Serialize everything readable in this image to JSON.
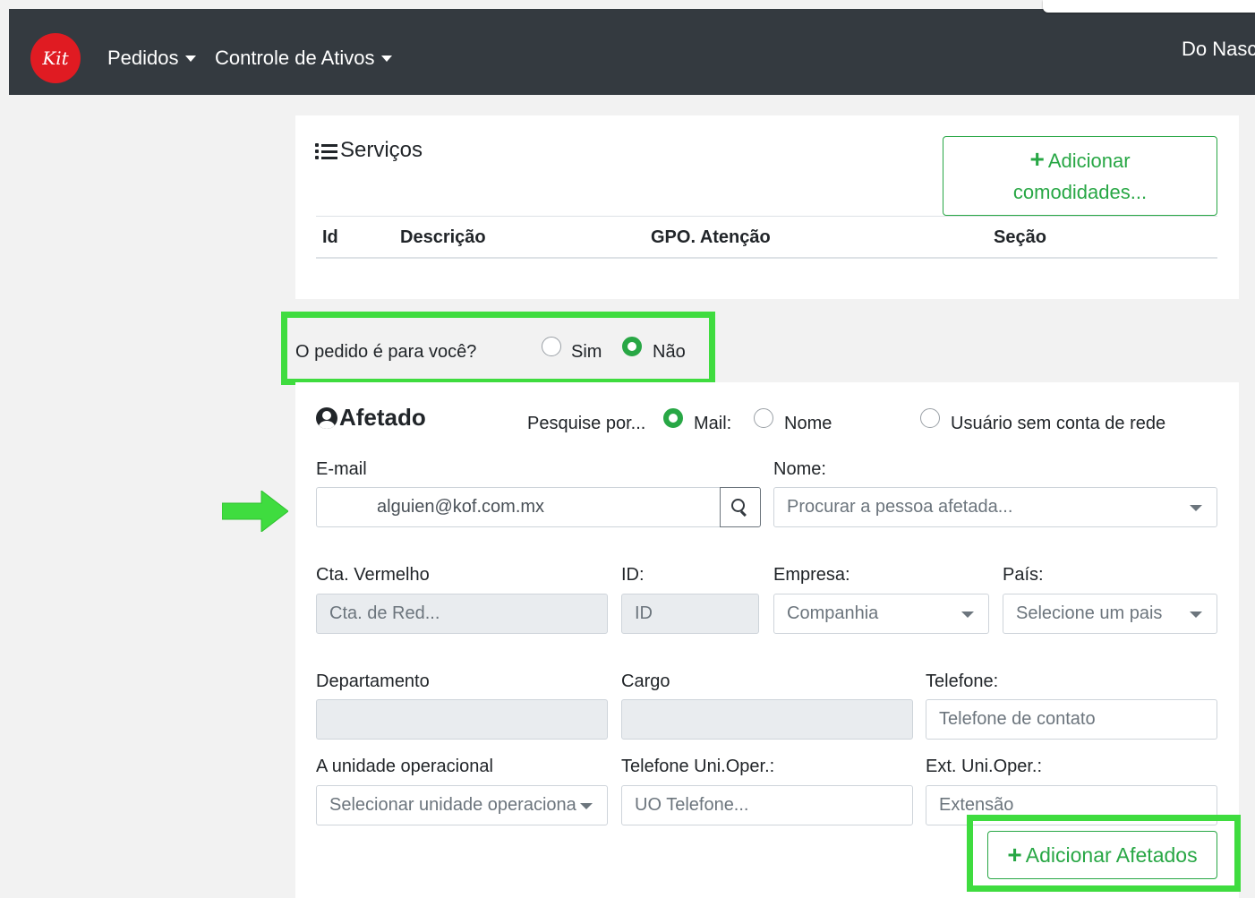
{
  "navbar": {
    "logo_text": "Kit",
    "items": [
      {
        "label": "Pedidos"
      },
      {
        "label": "Controle de Ativos"
      }
    ],
    "user_name": "Do Nasc"
  },
  "services": {
    "title": "Serviços",
    "add_button_line1": "Adicionar",
    "add_button_line2": "comodidades...",
    "columns": [
      "Id",
      "Descrição",
      "GPO. Atenção",
      "Seção"
    ]
  },
  "pedido_question": {
    "label": "O pedido é para você?",
    "options": [
      {
        "label": "Sim",
        "checked": false
      },
      {
        "label": "Não",
        "checked": true
      }
    ]
  },
  "afetado": {
    "title": "Afetado",
    "search_by_label": "Pesquise por...",
    "search_options": [
      {
        "label": "Mail:",
        "checked": true
      },
      {
        "label": "Nome",
        "checked": false
      },
      {
        "label": "Usuário sem conta de rede",
        "checked": false
      }
    ],
    "email_label": "E-mail",
    "email_value": "alguien@kof.com.mx",
    "name_label": "Nome:",
    "name_placeholder": "Procurar a pessoa afetada...",
    "cta_label": "Cta. Vermelho",
    "cta_placeholder": "Cta. de Red...",
    "id_label": "ID:",
    "id_placeholder": "ID",
    "empresa_label": "Empresa:",
    "empresa_placeholder": "Companhia",
    "pais_label": "País:",
    "pais_placeholder": "Selecione um pais",
    "departamento_label": "Departamento",
    "cargo_label": "Cargo",
    "telefone_label": "Telefone:",
    "telefone_placeholder": "Telefone de contato",
    "unidade_label": "A unidade operacional",
    "unidade_placeholder": "Selecionar unidade operaciona",
    "tel_uo_label": "Telefone Uni.Oper.:",
    "tel_uo_placeholder": "UO Telefone...",
    "ext_label": "Ext. Uni.Oper.:",
    "ext_placeholder": "Extensão",
    "add_button": "Adicionar Afetados"
  },
  "colors": {
    "navbar_bg": "#343a40",
    "accent_green": "#28a745",
    "highlight_green": "#3fdc3f",
    "logo_red": "#e01b22"
  }
}
